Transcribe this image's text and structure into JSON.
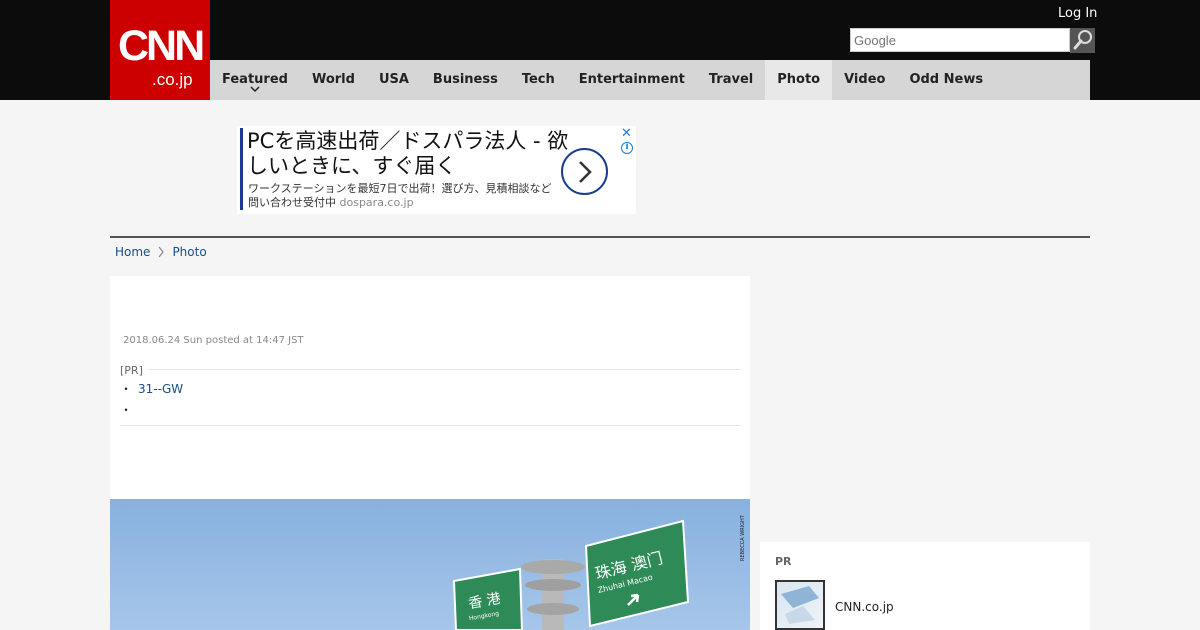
{
  "header": {
    "logo_main": "CNN",
    "logo_sub": ".co.jp",
    "login": "Log In",
    "search_placeholder": "Google"
  },
  "nav": {
    "items": [
      {
        "label": "Featured"
      },
      {
        "label": "World"
      },
      {
        "label": "USA"
      },
      {
        "label": "Business"
      },
      {
        "label": "Tech"
      },
      {
        "label": "Entertainment"
      },
      {
        "label": "Travel"
      },
      {
        "label": "Photo"
      },
      {
        "label": "Video"
      },
      {
        "label": "Odd News"
      }
    ],
    "active": "Photo"
  },
  "ad": {
    "headline": "PCを高速出荷／ドスパラ法人 - 欲しいときに、すぐ届く",
    "description": "ワークステーションを最短7日で出荷！選び方、見積相談など問い合わせ受付中",
    "domain": "dospara.co.jp",
    "close": "✕",
    "info": "i"
  },
  "breadcrumb": {
    "home": "Home",
    "current": "Photo"
  },
  "article": {
    "posted": "2018.06.24 Sun posted at 14:47 JST",
    "pr_label": "[PR]",
    "pr_link": "31--GW",
    "bullet": "・",
    "photo_credit": "REBECCA WRIGHT"
  },
  "sidebar": {
    "pr_title": "PR",
    "pr_item_name": "CNN.co.jp"
  },
  "colors": {
    "brand_red": "#cc0000",
    "header_bg": "#0c0c0c",
    "nav_bg": "#d6d6d6",
    "link": "#1a4c8a",
    "sign_green": "#2e8b57"
  }
}
